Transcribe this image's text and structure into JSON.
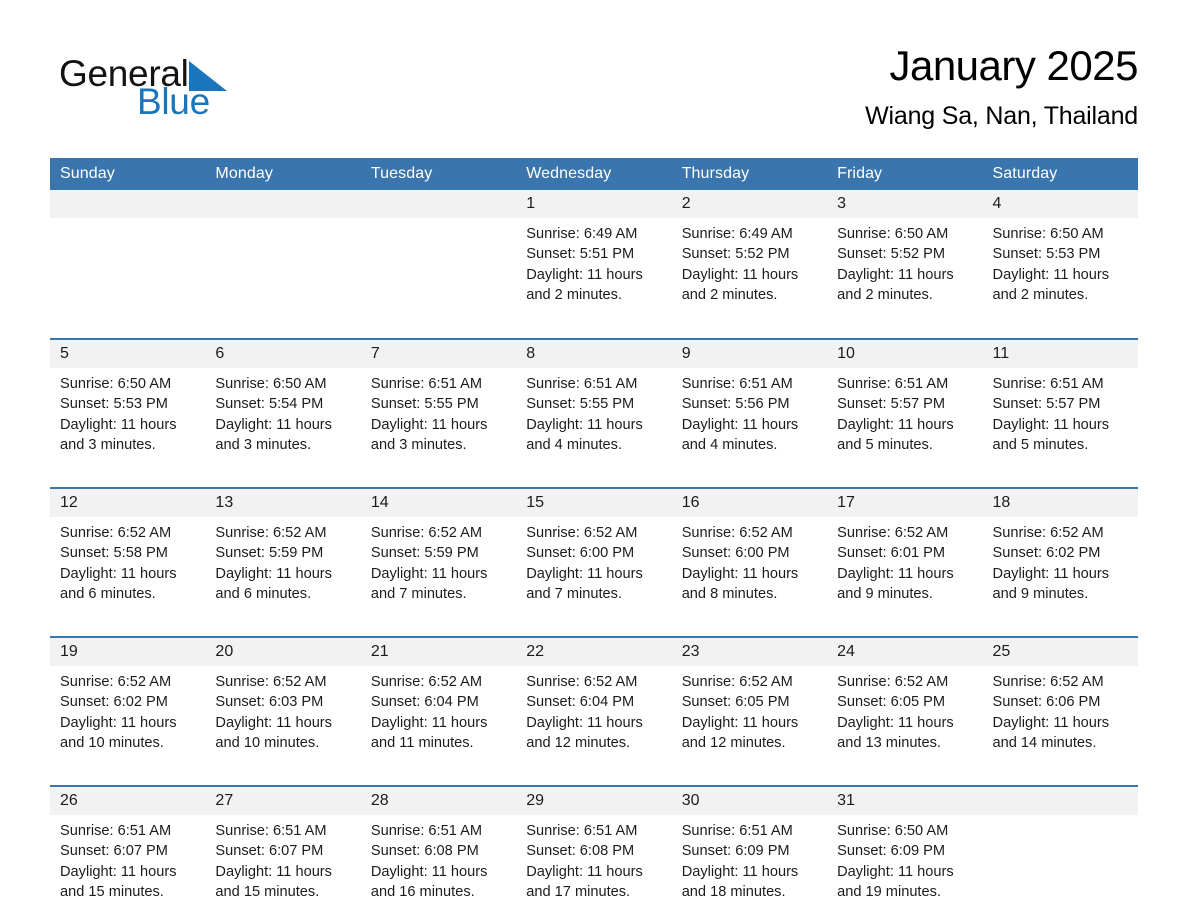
{
  "brand": {
    "name_part1": "General",
    "name_part2": "Blue",
    "triangle_color": "#1a76bc"
  },
  "header": {
    "title": "January 2025",
    "subtitle": "Wiang Sa, Nan, Thailand"
  },
  "theme": {
    "header_blue": "#3a76ad",
    "daynum_band": "#f2f2f2",
    "text": "#1c1c1c"
  },
  "calendar": {
    "weekday_headers": [
      "Sunday",
      "Monday",
      "Tuesday",
      "Wednesday",
      "Thursday",
      "Friday",
      "Saturday"
    ],
    "weeks": [
      [
        {
          "day": "",
          "sunrise": "",
          "sunset": "",
          "daylight_line1": "",
          "daylight_line2": ""
        },
        {
          "day": "",
          "sunrise": "",
          "sunset": "",
          "daylight_line1": "",
          "daylight_line2": ""
        },
        {
          "day": "",
          "sunrise": "",
          "sunset": "",
          "daylight_line1": "",
          "daylight_line2": ""
        },
        {
          "day": "1",
          "sunrise": "Sunrise: 6:49 AM",
          "sunset": "Sunset: 5:51 PM",
          "daylight_line1": "Daylight: 11 hours",
          "daylight_line2": "and 2 minutes."
        },
        {
          "day": "2",
          "sunrise": "Sunrise: 6:49 AM",
          "sunset": "Sunset: 5:52 PM",
          "daylight_line1": "Daylight: 11 hours",
          "daylight_line2": "and 2 minutes."
        },
        {
          "day": "3",
          "sunrise": "Sunrise: 6:50 AM",
          "sunset": "Sunset: 5:52 PM",
          "daylight_line1": "Daylight: 11 hours",
          "daylight_line2": "and 2 minutes."
        },
        {
          "day": "4",
          "sunrise": "Sunrise: 6:50 AM",
          "sunset": "Sunset: 5:53 PM",
          "daylight_line1": "Daylight: 11 hours",
          "daylight_line2": "and 2 minutes."
        }
      ],
      [
        {
          "day": "5",
          "sunrise": "Sunrise: 6:50 AM",
          "sunset": "Sunset: 5:53 PM",
          "daylight_line1": "Daylight: 11 hours",
          "daylight_line2": "and 3 minutes."
        },
        {
          "day": "6",
          "sunrise": "Sunrise: 6:50 AM",
          "sunset": "Sunset: 5:54 PM",
          "daylight_line1": "Daylight: 11 hours",
          "daylight_line2": "and 3 minutes."
        },
        {
          "day": "7",
          "sunrise": "Sunrise: 6:51 AM",
          "sunset": "Sunset: 5:55 PM",
          "daylight_line1": "Daylight: 11 hours",
          "daylight_line2": "and 3 minutes."
        },
        {
          "day": "8",
          "sunrise": "Sunrise: 6:51 AM",
          "sunset": "Sunset: 5:55 PM",
          "daylight_line1": "Daylight: 11 hours",
          "daylight_line2": "and 4 minutes."
        },
        {
          "day": "9",
          "sunrise": "Sunrise: 6:51 AM",
          "sunset": "Sunset: 5:56 PM",
          "daylight_line1": "Daylight: 11 hours",
          "daylight_line2": "and 4 minutes."
        },
        {
          "day": "10",
          "sunrise": "Sunrise: 6:51 AM",
          "sunset": "Sunset: 5:57 PM",
          "daylight_line1": "Daylight: 11 hours",
          "daylight_line2": "and 5 minutes."
        },
        {
          "day": "11",
          "sunrise": "Sunrise: 6:51 AM",
          "sunset": "Sunset: 5:57 PM",
          "daylight_line1": "Daylight: 11 hours",
          "daylight_line2": "and 5 minutes."
        }
      ],
      [
        {
          "day": "12",
          "sunrise": "Sunrise: 6:52 AM",
          "sunset": "Sunset: 5:58 PM",
          "daylight_line1": "Daylight: 11 hours",
          "daylight_line2": "and 6 minutes."
        },
        {
          "day": "13",
          "sunrise": "Sunrise: 6:52 AM",
          "sunset": "Sunset: 5:59 PM",
          "daylight_line1": "Daylight: 11 hours",
          "daylight_line2": "and 6 minutes."
        },
        {
          "day": "14",
          "sunrise": "Sunrise: 6:52 AM",
          "sunset": "Sunset: 5:59 PM",
          "daylight_line1": "Daylight: 11 hours",
          "daylight_line2": "and 7 minutes."
        },
        {
          "day": "15",
          "sunrise": "Sunrise: 6:52 AM",
          "sunset": "Sunset: 6:00 PM",
          "daylight_line1": "Daylight: 11 hours",
          "daylight_line2": "and 7 minutes."
        },
        {
          "day": "16",
          "sunrise": "Sunrise: 6:52 AM",
          "sunset": "Sunset: 6:00 PM",
          "daylight_line1": "Daylight: 11 hours",
          "daylight_line2": "and 8 minutes."
        },
        {
          "day": "17",
          "sunrise": "Sunrise: 6:52 AM",
          "sunset": "Sunset: 6:01 PM",
          "daylight_line1": "Daylight: 11 hours",
          "daylight_line2": "and 9 minutes."
        },
        {
          "day": "18",
          "sunrise": "Sunrise: 6:52 AM",
          "sunset": "Sunset: 6:02 PM",
          "daylight_line1": "Daylight: 11 hours",
          "daylight_line2": "and 9 minutes."
        }
      ],
      [
        {
          "day": "19",
          "sunrise": "Sunrise: 6:52 AM",
          "sunset": "Sunset: 6:02 PM",
          "daylight_line1": "Daylight: 11 hours",
          "daylight_line2": "and 10 minutes."
        },
        {
          "day": "20",
          "sunrise": "Sunrise: 6:52 AM",
          "sunset": "Sunset: 6:03 PM",
          "daylight_line1": "Daylight: 11 hours",
          "daylight_line2": "and 10 minutes."
        },
        {
          "day": "21",
          "sunrise": "Sunrise: 6:52 AM",
          "sunset": "Sunset: 6:04 PM",
          "daylight_line1": "Daylight: 11 hours",
          "daylight_line2": "and 11 minutes."
        },
        {
          "day": "22",
          "sunrise": "Sunrise: 6:52 AM",
          "sunset": "Sunset: 6:04 PM",
          "daylight_line1": "Daylight: 11 hours",
          "daylight_line2": "and 12 minutes."
        },
        {
          "day": "23",
          "sunrise": "Sunrise: 6:52 AM",
          "sunset": "Sunset: 6:05 PM",
          "daylight_line1": "Daylight: 11 hours",
          "daylight_line2": "and 12 minutes."
        },
        {
          "day": "24",
          "sunrise": "Sunrise: 6:52 AM",
          "sunset": "Sunset: 6:05 PM",
          "daylight_line1": "Daylight: 11 hours",
          "daylight_line2": "and 13 minutes."
        },
        {
          "day": "25",
          "sunrise": "Sunrise: 6:52 AM",
          "sunset": "Sunset: 6:06 PM",
          "daylight_line1": "Daylight: 11 hours",
          "daylight_line2": "and 14 minutes."
        }
      ],
      [
        {
          "day": "26",
          "sunrise": "Sunrise: 6:51 AM",
          "sunset": "Sunset: 6:07 PM",
          "daylight_line1": "Daylight: 11 hours",
          "daylight_line2": "and 15 minutes."
        },
        {
          "day": "27",
          "sunrise": "Sunrise: 6:51 AM",
          "sunset": "Sunset: 6:07 PM",
          "daylight_line1": "Daylight: 11 hours",
          "daylight_line2": "and 15 minutes."
        },
        {
          "day": "28",
          "sunrise": "Sunrise: 6:51 AM",
          "sunset": "Sunset: 6:08 PM",
          "daylight_line1": "Daylight: 11 hours",
          "daylight_line2": "and 16 minutes."
        },
        {
          "day": "29",
          "sunrise": "Sunrise: 6:51 AM",
          "sunset": "Sunset: 6:08 PM",
          "daylight_line1": "Daylight: 11 hours",
          "daylight_line2": "and 17 minutes."
        },
        {
          "day": "30",
          "sunrise": "Sunrise: 6:51 AM",
          "sunset": "Sunset: 6:09 PM",
          "daylight_line1": "Daylight: 11 hours",
          "daylight_line2": "and 18 minutes."
        },
        {
          "day": "31",
          "sunrise": "Sunrise: 6:50 AM",
          "sunset": "Sunset: 6:09 PM",
          "daylight_line1": "Daylight: 11 hours",
          "daylight_line2": "and 19 minutes."
        },
        {
          "day": "",
          "sunrise": "",
          "sunset": "",
          "daylight_line1": "",
          "daylight_line2": ""
        }
      ]
    ]
  }
}
